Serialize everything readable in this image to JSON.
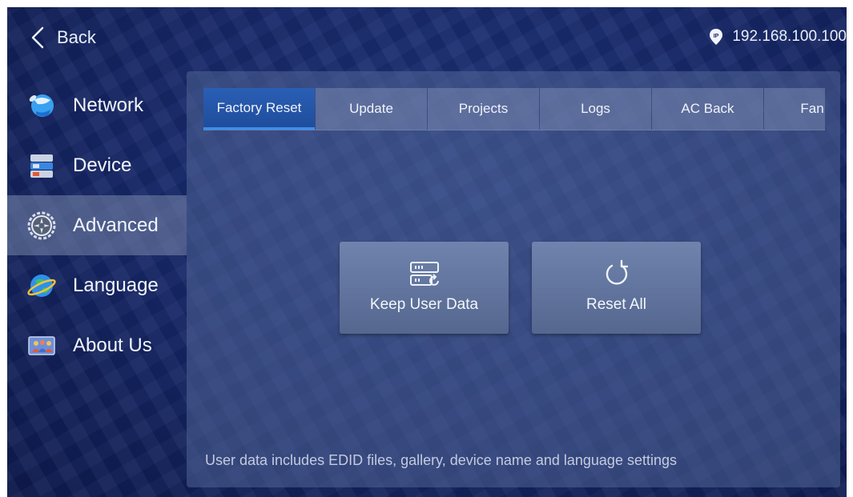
{
  "header": {
    "back_label": "Back",
    "ip_address": "192.168.100.100"
  },
  "sidebar": {
    "items": [
      {
        "label": "Network",
        "icon": "network-globe-icon"
      },
      {
        "label": "Device",
        "icon": "device-server-icon"
      },
      {
        "label": "Advanced",
        "icon": "gear-icon",
        "active": true
      },
      {
        "label": "Language",
        "icon": "language-globe-icon"
      },
      {
        "label": "About Us",
        "icon": "about-us-people-icon"
      }
    ]
  },
  "tabs": [
    {
      "label": "Factory Reset",
      "active": true
    },
    {
      "label": "Update"
    },
    {
      "label": "Projects"
    },
    {
      "label": "Logs"
    },
    {
      "label": "AC Back"
    },
    {
      "label": "Fan M"
    }
  ],
  "actions": {
    "keep_user_data": {
      "label": "Keep User Data",
      "icon": "server-refresh-icon"
    },
    "reset_all": {
      "label": "Reset All",
      "icon": "refresh-icon"
    }
  },
  "note": "User data includes EDID files, gallery, device name and language settings",
  "colors": {
    "background": "#17286a",
    "accent": "#3b8ff0",
    "active_tab": "#2a5fb5"
  }
}
